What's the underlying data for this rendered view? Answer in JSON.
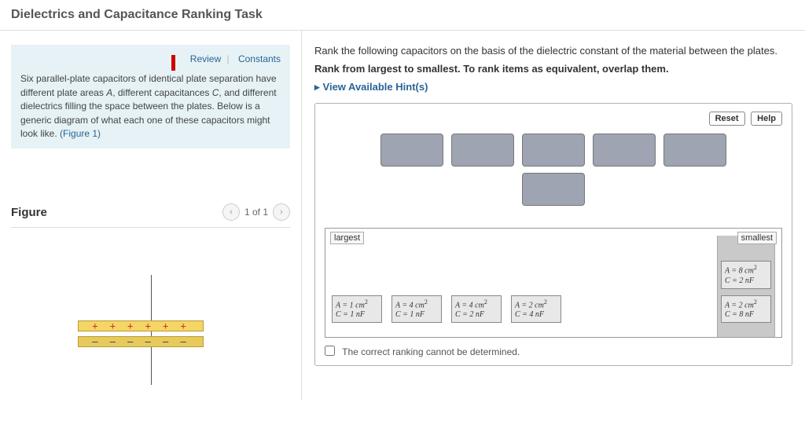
{
  "header": {
    "title": "Dielectrics and Capacitance Ranking Task"
  },
  "info": {
    "review": "Review",
    "constants": "Constants",
    "body_pre": "Six parallel-plate capacitors of identical plate separation have different plate areas ",
    "A": "A",
    "body_mid1": ", different capacitances ",
    "C": "C",
    "body_mid2": ", and different dielectrics filling the space between the plates. Below is a generic diagram of what each one of these capacitors might look like. ",
    "figure_ref": "(Figure 1)"
  },
  "figure": {
    "heading": "Figure",
    "pager": "1 of 1",
    "top_plate": "+ + + + + +",
    "bot_plate": "— — — — — —"
  },
  "question": {
    "line1": "Rank the following capacitors on the basis of the dielectric constant of the material between the plates.",
    "line2": "Rank from largest to smallest. To rank items as equivalent, overlap them.",
    "hints": "View Available Hint(s)"
  },
  "box": {
    "reset": "Reset",
    "help": "Help",
    "largest": "largest",
    "smallest": "smallest",
    "cannot": "The correct ranking cannot be determined."
  },
  "tiles": [
    {
      "A": "A = 1 cm",
      "C": "C = 1 nF"
    },
    {
      "A": "A = 4 cm",
      "C": "C = 1 nF"
    },
    {
      "A": "A = 4 cm",
      "C": "C = 2 nF"
    },
    {
      "A": "A = 2 cm",
      "C": "C = 4 nF"
    },
    {
      "A": "A = 8 cm",
      "C": "C = 2 nF"
    },
    {
      "A": "A = 2 cm",
      "C": "C = 8 nF"
    }
  ]
}
